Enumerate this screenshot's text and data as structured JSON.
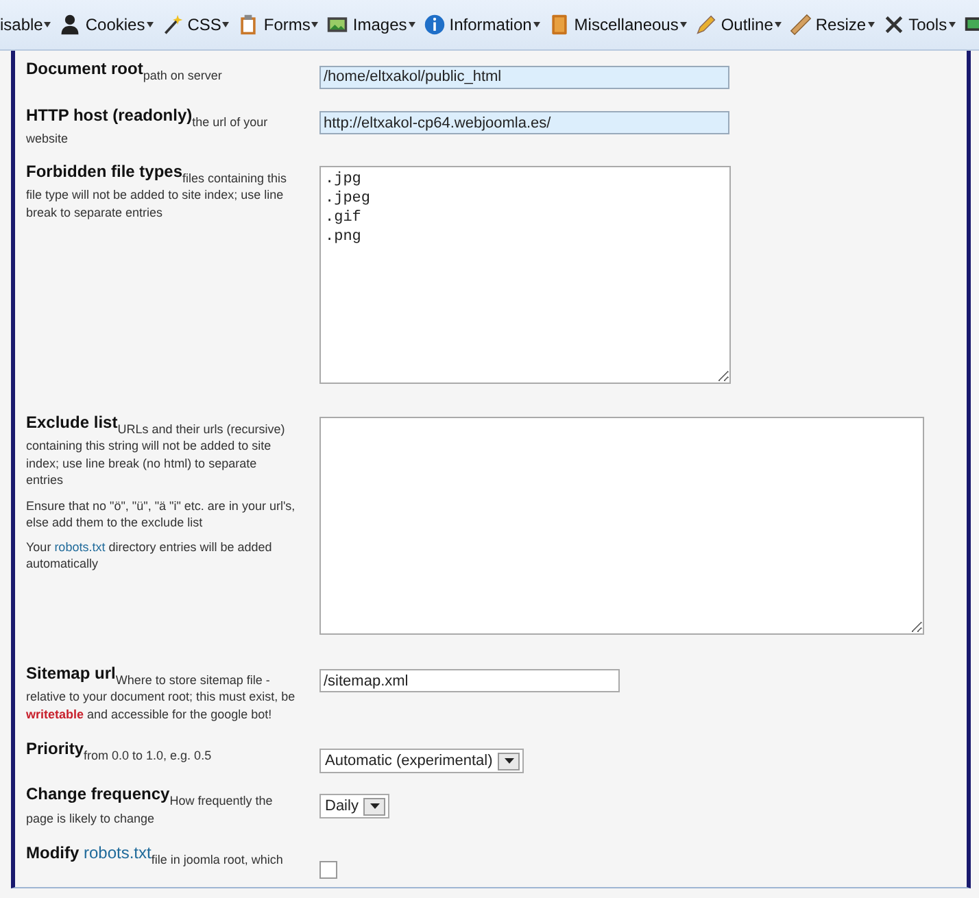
{
  "toolbar": [
    {
      "label": "isable",
      "kind": "none"
    },
    {
      "label": "Cookies",
      "kind": "person"
    },
    {
      "label": "CSS",
      "kind": "wand"
    },
    {
      "label": "Forms",
      "kind": "clipboard"
    },
    {
      "label": "Images",
      "kind": "image"
    },
    {
      "label": "Information",
      "kind": "info"
    },
    {
      "label": "Miscellaneous",
      "kind": "book"
    },
    {
      "label": "Outline",
      "kind": "pencil"
    },
    {
      "label": "Resize",
      "kind": "ruler"
    },
    {
      "label": "Tools",
      "kind": "tools"
    },
    {
      "kind": "monitor"
    }
  ],
  "settings": [
    {
      "label": [
        {
          "text": "Document root",
          "kind": "plain"
        }
      ],
      "description": [
        [
          {
            "text": "path on server",
            "kind": "plain"
          }
        ]
      ],
      "control": {
        "kind": "input",
        "value": "/home/eltxakol/public_html",
        "highlighted": true
      }
    },
    {
      "label": [
        {
          "text": "HTTP host (readonly)",
          "kind": "plain"
        }
      ],
      "description": [
        [
          {
            "text": "the url of your website",
            "kind": "plain"
          }
        ]
      ],
      "control": {
        "kind": "input",
        "value": "http://eltxakol-cp64.webjoomla.es/",
        "highlighted": true
      }
    },
    {
      "label": [
        {
          "text": "Forbidden file types",
          "kind": "plain"
        }
      ],
      "description": [
        [
          {
            "text": "files containing this file type will not be added to site index; use line break to separate entries",
            "kind": "plain"
          }
        ]
      ],
      "control": {
        "kind": "textarea",
        "lines": [
          ".jpg",
          ".jpeg",
          ".gif",
          ".png"
        ]
      }
    },
    {
      "label": [
        {
          "text": "Exclude list",
          "kind": "plain"
        }
      ],
      "description": [
        [
          {
            "text": "URLs and their urls (recursive) containing this string will not be added to site index; use line break (no html) to separate entries",
            "kind": "plain"
          }
        ],
        [
          {
            "text": "Ensure that no \"ö\", \"ü\", \"ä \"i\" etc. are in your url's, else add them to the exclude list",
            "kind": "plain"
          }
        ],
        [
          {
            "text": "Your ",
            "kind": "plain"
          },
          {
            "text": "robots.txt",
            "kind": "link"
          },
          {
            "text": " directory entries will be added automatically",
            "kind": "plain"
          }
        ]
      ],
      "control": {
        "kind": "textarea"
      }
    },
    {
      "label": [
        {
          "text": "Sitemap url",
          "kind": "plain"
        }
      ],
      "description": [
        [
          {
            "text": "Where to store sitemap file - relative to your document root; this must exist, be ",
            "kind": "plain"
          },
          {
            "text": "writetable",
            "kind": "warning"
          },
          {
            "text": " and accessible for the google bot!",
            "kind": "plain"
          }
        ]
      ],
      "control": {
        "kind": "input",
        "value": "/sitemap.xml",
        "highlighted": false
      }
    },
    {
      "label": [
        {
          "text": "Priority",
          "kind": "plain"
        }
      ],
      "description": [
        [
          {
            "text": "from 0.0 to 1.0, e.g. 0.5",
            "kind": "plain"
          }
        ]
      ],
      "control": {
        "kind": "select",
        "value": "Automatic (experimental)"
      }
    },
    {
      "label": [
        {
          "text": "Change frequency",
          "kind": "plain"
        }
      ],
      "description": [
        [
          {
            "text": "How frequently the page is likely to change",
            "kind": "plain"
          }
        ]
      ],
      "control": {
        "kind": "select",
        "value": "Daily"
      }
    },
    {
      "label": [
        {
          "text": "Modify ",
          "kind": "plain"
        },
        {
          "text": "robots.txt",
          "kind": "link"
        }
      ],
      "description": [
        [
          {
            "text": "file in joomla root, which",
            "kind": "plain"
          }
        ]
      ],
      "control": {
        "kind": "checkbox",
        "checked": false
      }
    }
  ]
}
